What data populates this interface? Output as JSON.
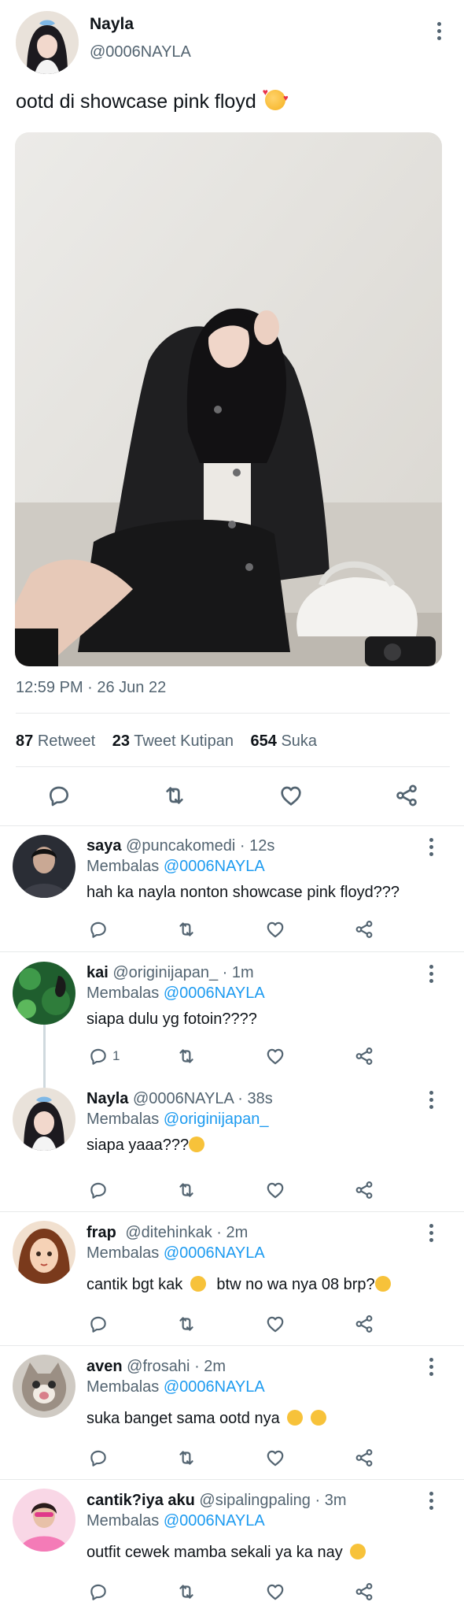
{
  "tweet": {
    "author_name": "Nayla",
    "author_handle": "@0006NAYLA",
    "text": "ootd di showcase pink floyd",
    "timestamp": "12:59 PM · 26 Jun 22",
    "stats": {
      "retweets_count": "87",
      "retweets_label": "Retweet",
      "quotes_count": "23",
      "quotes_label": "Tweet Kutipan",
      "likes_count": "654",
      "likes_label": "Suka"
    }
  },
  "replies": [
    {
      "name": "saya",
      "handle": "@puncakomedi",
      "time": "· 12s",
      "replying_label": "Membalas",
      "replying_to": "@0006NAYLA",
      "text": "hah ka nayla nonton showcase pink floyd???",
      "reply_count": ""
    },
    {
      "name": "kai",
      "handle": "@originijapan_",
      "time": "· 1m",
      "replying_label": "Membalas",
      "replying_to": "@0006NAYLA",
      "text": "siapa dulu yg fotoin????",
      "reply_count": "1"
    },
    {
      "name": "Nayla",
      "handle": "@0006NAYLA",
      "time": "· 38s",
      "replying_label": "Membalas",
      "replying_to": "@originijapan_",
      "text": "siapa yaaa???",
      "reply_count": ""
    },
    {
      "name": "frap",
      "handle": "@ditehinkak",
      "time": "· 2m",
      "replying_label": "Membalas",
      "replying_to": "@0006NAYLA",
      "text": "cantik bgt kak",
      "text2": "btw no wa nya 08 brp?",
      "reply_count": ""
    },
    {
      "name": "aven",
      "handle": "@frosahi",
      "time": "· 2m",
      "replying_label": "Membalas",
      "replying_to": "@0006NAYLA",
      "text": "suka banget sama ootd nya",
      "reply_count": ""
    },
    {
      "name": "cantik?iya aku",
      "handle": "@sipalingpaling",
      "time": "· 3m",
      "replying_label": "Membalas",
      "replying_to": "@0006NAYLA",
      "text": "outfit cewek mamba sekali ya ka nay",
      "reply_count": ""
    }
  ],
  "icons": {
    "reply": "speech-bubble",
    "retweet": "retweet-arrows",
    "like": "heart",
    "share": "share-nodes",
    "more": "vertical-ellipsis"
  },
  "colors": {
    "link": "#1d9bf0",
    "muted": "#536471",
    "text": "#0f1419",
    "divider": "#e7e9ea"
  }
}
